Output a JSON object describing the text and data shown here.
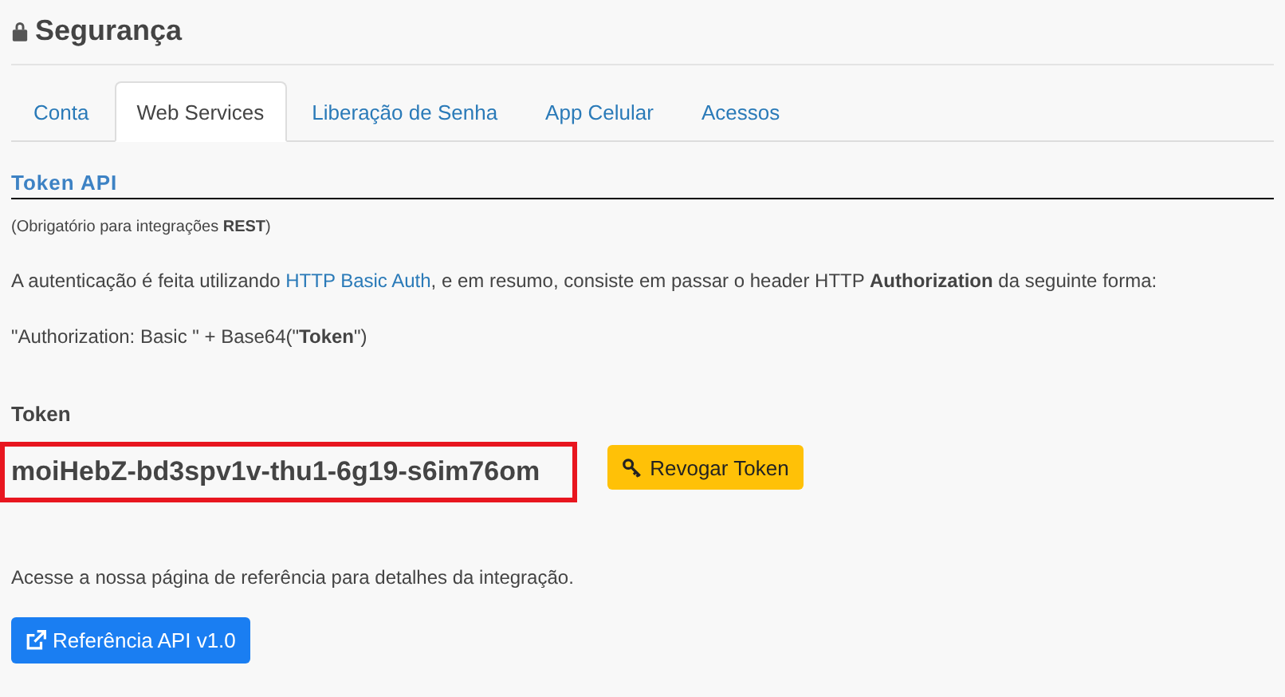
{
  "page_title": "Segurança",
  "tabs": [
    {
      "label": "Conta",
      "selected": false
    },
    {
      "label": "Web Services",
      "selected": true
    },
    {
      "label": "Liberação de Senha",
      "selected": false
    },
    {
      "label": "App Celular",
      "selected": false
    },
    {
      "label": "Acessos",
      "selected": false
    }
  ],
  "section_title": "Token API",
  "note": "(Obrigatório para integrações **REST**)",
  "auth_text": {
    "before": "A autenticação é feita utilizando ",
    "link": "HTTP Basic Auth",
    "after": ", e em resumo, consiste em passar o header HTTP **Authorization** da seguinte forma:"
  },
  "header_format": "\"Authorization: Basic \" + Base64(\"**Token**\")",
  "token_label": "Token",
  "token_value": "moiHebZ-bd3spv1v-thu1-6g19-s6im76om",
  "revoke_button": "Revogar Token",
  "reference_text": "Acesse a nossa página de referência para detalhes da integração.",
  "reference_button": "Referência API v1.0"
}
